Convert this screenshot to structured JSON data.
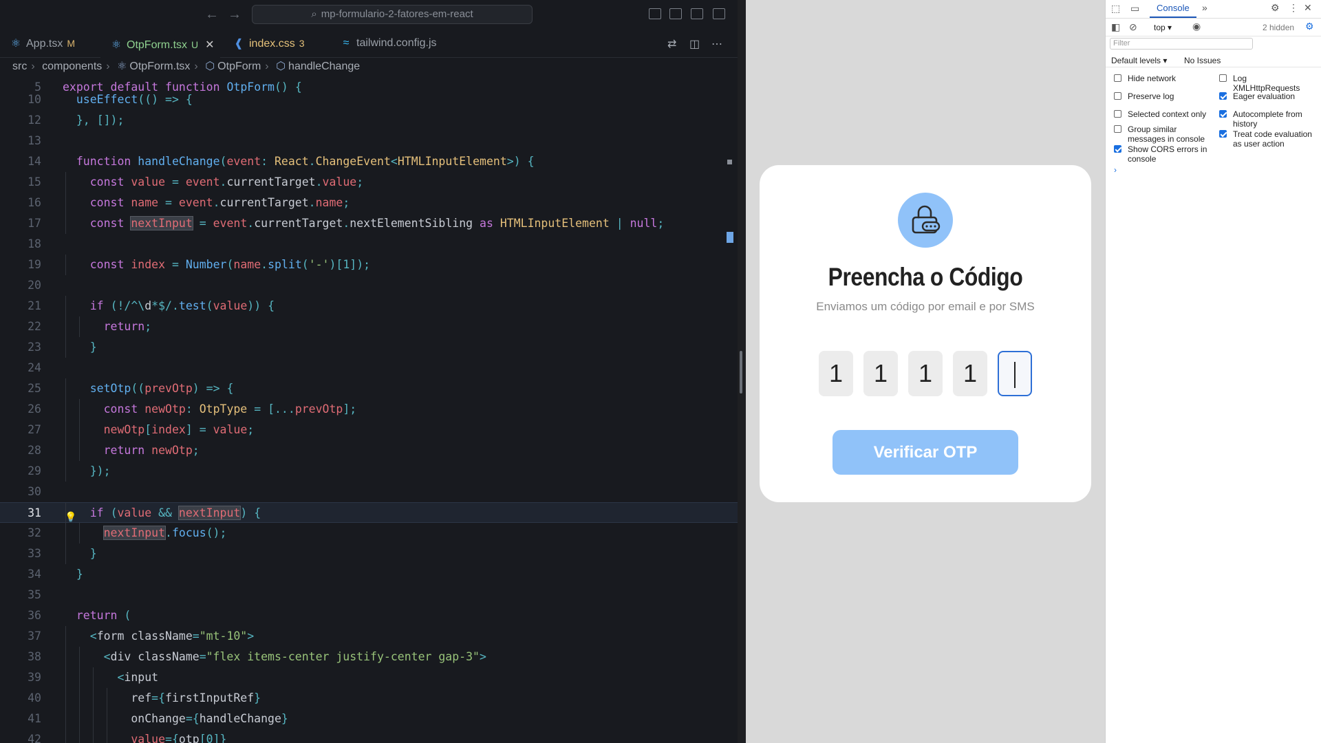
{
  "editor": {
    "search_text": "mp-formulario-2-fatores-em-react",
    "tabs": [
      {
        "name": "App.tsx",
        "mark": "M",
        "icon": "react-icon"
      },
      {
        "name": "OtpForm.tsx",
        "mark": "U",
        "icon": "react-icon"
      },
      {
        "name": "index.css",
        "mark": "3",
        "icon": "css-icon"
      },
      {
        "name": "tailwind.config.js",
        "mark": "",
        "icon": "tailwind-icon"
      }
    ],
    "breadcrumb": [
      "src",
      "components",
      "OtpForm.tsx",
      "OtpForm",
      "handleChange"
    ],
    "line_numbers": [
      "5",
      "10",
      "12",
      "13",
      "14",
      "15",
      "16",
      "17",
      "18",
      "19",
      "20",
      "21",
      "22",
      "23",
      "24",
      "25",
      "26",
      "27",
      "28",
      "29",
      "30",
      "31",
      "32",
      "33",
      "34",
      "35",
      "36",
      "37",
      "38",
      "39",
      "40",
      "41",
      "42"
    ],
    "current_line": "31",
    "code_lines": [
      "export default function OtpForm() {",
      "  useEffect(() => {",
      "  }, []);",
      "",
      "  function handleChange(event: React.ChangeEvent<HTMLInputElement>) {",
      "    const value = event.currentTarget.value;",
      "    const name = event.currentTarget.name;",
      "    const nextInput = event.currentTarget.nextElementSibling as HTMLInputElement | null;",
      "",
      "    const index = Number(name.split('-')[1]);",
      "",
      "    if (!/^\\d*$/.test(value)) {",
      "      return;",
      "    }",
      "",
      "    setOtp((prevOtp) => {",
      "      const newOtp: OtpType = [...prevOtp];",
      "      newOtp[index] = value;",
      "      return newOtp;",
      "    });",
      "",
      "    if (value && nextInput) {",
      "      nextInput.focus();",
      "    }",
      "  }",
      "",
      "  return (",
      "    <form className=\"mt-10\">",
      "      <div className=\"flex items-center justify-center gap-3\">",
      "        <input",
      "          ref={firstInputRef}",
      "          onChange={handleChange}",
      "          value={otp[0]}"
    ]
  },
  "page": {
    "title": "Preencha o Código",
    "subtitle": "Enviamos um código por email e por SMS",
    "otp_digits": [
      "1",
      "1",
      "1",
      "1",
      ""
    ],
    "button_label": "Verificar OTP",
    "colors": {
      "accent": "#90c2f9",
      "focus_border": "#2d6fd6",
      "card": "#ffffff",
      "background": "#d9d9d9"
    }
  },
  "devtools": {
    "active_tab": "Console",
    "context": "top",
    "hidden_count": "2 hidden",
    "filter_placeholder": "Filter",
    "levels": "Default levels",
    "issues": "No Issues",
    "options_left": [
      {
        "label": "Hide network",
        "checked": false
      },
      {
        "label": "Preserve log",
        "checked": false
      },
      {
        "label": "Selected context only",
        "checked": false
      },
      {
        "label": "Group similar messages in console",
        "checked": false
      },
      {
        "label": "Show CORS errors in console",
        "checked": true
      }
    ],
    "options_right": [
      {
        "label": "Log XMLHttpRequests",
        "checked": false
      },
      {
        "label": "Eager evaluation",
        "checked": true
      },
      {
        "label": "Autocomplete from history",
        "checked": true
      },
      {
        "label": "Treat code evaluation as user action",
        "checked": true
      }
    ],
    "prompt": "›"
  }
}
